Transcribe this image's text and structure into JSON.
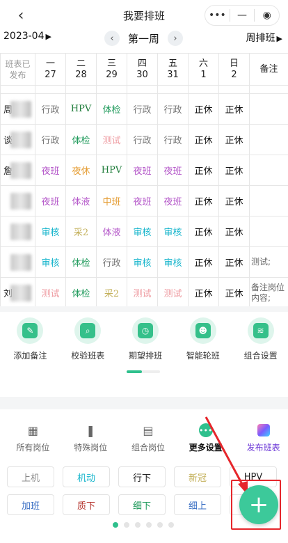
{
  "header": {
    "title": "我要排班",
    "back": "‹",
    "menu_dots": "•••",
    "minimize": "—",
    "close": "◉"
  },
  "weekbar": {
    "month": "2023-04",
    "week": "第一周",
    "prev": "‹",
    "next": "›",
    "mode": "周排班"
  },
  "table": {
    "corner": "班表已\n发布",
    "columns": [
      {
        "day": "一",
        "date": "27"
      },
      {
        "day": "二",
        "date": "28"
      },
      {
        "day": "三",
        "date": "29"
      },
      {
        "day": "四",
        "date": "30"
      },
      {
        "day": "五",
        "date": "31"
      },
      {
        "day": "六",
        "date": "1"
      },
      {
        "day": "日",
        "date": "2"
      }
    ],
    "note_header": "备注",
    "rows": [
      {
        "name": "周",
        "cells": [
          [
            "行政",
            "gray"
          ],
          [
            "HPV",
            "darkgreen"
          ],
          [
            "体检",
            "green"
          ],
          [
            "行政",
            "gray"
          ],
          [
            "行政",
            "gray"
          ],
          [
            "正休",
            "black"
          ],
          [
            "正休",
            "black"
          ]
        ],
        "note": ""
      },
      {
        "name": "谈",
        "cells": [
          [
            "行政",
            "gray"
          ],
          [
            "体检",
            "green"
          ],
          [
            "测试",
            "pink"
          ],
          [
            "行政",
            "gray"
          ],
          [
            "行政",
            "gray"
          ],
          [
            "正休",
            "black"
          ],
          [
            "正休",
            "black"
          ]
        ],
        "note": ""
      },
      {
        "name": "詹",
        "cells": [
          [
            "夜班",
            "purple"
          ],
          [
            "夜休",
            "orange"
          ],
          [
            "HPV",
            "darkgreen"
          ],
          [
            "夜班",
            "purple"
          ],
          [
            "夜班",
            "purple"
          ],
          [
            "正休",
            "black"
          ],
          [
            "正休",
            "black"
          ]
        ],
        "note": ""
      },
      {
        "name": "",
        "cells": [
          [
            "夜班",
            "purple"
          ],
          [
            "体液",
            "purple"
          ],
          [
            "中班",
            "orange"
          ],
          [
            "夜班",
            "purple"
          ],
          [
            "夜班",
            "purple"
          ],
          [
            "正休",
            "black"
          ],
          [
            "正休",
            "black"
          ]
        ],
        "note": ""
      },
      {
        "name": "",
        "cells": [
          [
            "审核",
            "cyan"
          ],
          [
            "采2",
            "khaki"
          ],
          [
            "体液",
            "purple"
          ],
          [
            "审核",
            "cyan"
          ],
          [
            "审核",
            "cyan"
          ],
          [
            "正休",
            "black"
          ],
          [
            "正休",
            "black"
          ]
        ],
        "note": ""
      },
      {
        "name": "",
        "cells": [
          [
            "审核",
            "cyan"
          ],
          [
            "体检",
            "green"
          ],
          [
            "行政",
            "gray"
          ],
          [
            "审核",
            "cyan"
          ],
          [
            "审核",
            "cyan"
          ],
          [
            "正休",
            "black"
          ],
          [
            "正休",
            "black"
          ]
        ],
        "note": "测试;"
      },
      {
        "name": "刘",
        "cells": [
          [
            "测试",
            "pink"
          ],
          [
            "体检",
            "green"
          ],
          [
            "采2",
            "khaki"
          ],
          [
            "测试",
            "pink"
          ],
          [
            "测试",
            "pink"
          ],
          [
            "正休",
            "black"
          ],
          [
            "正休",
            "black"
          ]
        ],
        "note": "备注岗位内容;"
      }
    ]
  },
  "tools": [
    {
      "label": "添加备注",
      "icon": "note-edit-icon",
      "glyph": "✎"
    },
    {
      "label": "校验班表",
      "icon": "search-doc-icon",
      "glyph": "⌕"
    },
    {
      "label": "期望排班",
      "icon": "calendar-clock-icon",
      "glyph": "◷"
    },
    {
      "label": "智能轮班",
      "icon": "robot-icon",
      "glyph": "☻"
    },
    {
      "label": "组合设置",
      "icon": "layers-icon",
      "glyph": "≋"
    }
  ],
  "categories": [
    {
      "label": "所有岗位",
      "icon": "grid-icon",
      "glyph": "▦"
    },
    {
      "label": "特殊岗位",
      "icon": "bookmark-icon",
      "glyph": "❚"
    },
    {
      "label": "组合岗位",
      "icon": "ticket-icon",
      "glyph": "▤"
    },
    {
      "label": "更多设置",
      "icon": "more-icon",
      "glyph": "•••"
    },
    {
      "label": "发布班表",
      "icon": "publish-icon",
      "glyph": ""
    }
  ],
  "chips": [
    [
      [
        "上机",
        "#888888"
      ],
      [
        "机动",
        "#13b4cb"
      ],
      [
        "行下",
        "#222222"
      ],
      [
        "新冠",
        "#c3b05a"
      ],
      [
        "HPV",
        "#222222"
      ]
    ],
    [
      [
        "加班",
        "#3a6fc4"
      ],
      [
        "质下",
        "#b4322b"
      ],
      [
        "细下",
        "#1f9a5b"
      ],
      [
        "细上",
        "#3a6fc4"
      ],
      [
        "",
        ""
      ]
    ]
  ],
  "fab": "+"
}
